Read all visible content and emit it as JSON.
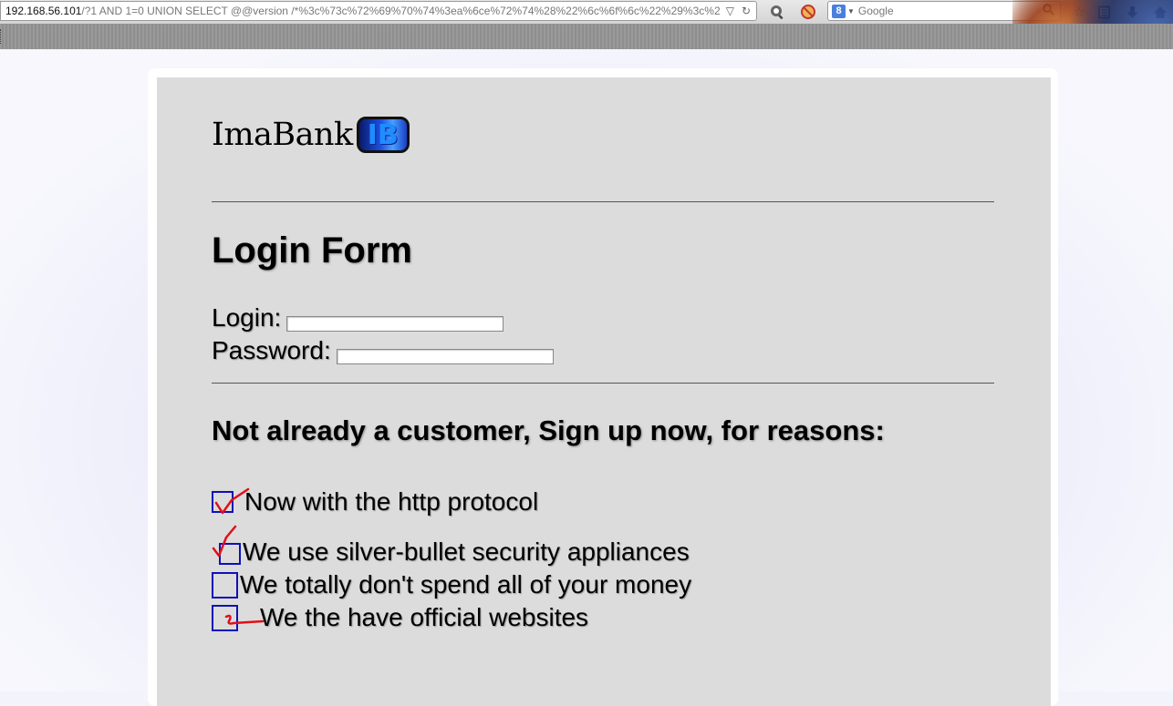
{
  "browser": {
    "url_host": "192.168.56.101",
    "url_path": "/?1 AND 1=0 UNION SELECT @@version /*%3c%73c%72%69%70%74%3ea%6ce%72%74%28%22%6c%6f%6c%22%29%3c%2",
    "search_engine_badge": "8",
    "search_placeholder": "Google",
    "icons": [
      "dropdown-arrow-icon",
      "reload-icon",
      "search-addon-icon",
      "blocked-icon",
      "search-magnifier-icon",
      "star-icon",
      "bookmarks-icon",
      "download-icon",
      "home-icon"
    ]
  },
  "page": {
    "logo_text": "ImaBank",
    "logo_badge": "IB",
    "title": "Login Form",
    "login_label": "Login:",
    "login_value": "",
    "password_label": "Password:",
    "password_value": "",
    "signup_heading": "Not already a customer, Sign up now, for reasons:",
    "reasons": [
      {
        "label": "Now with the http protocol",
        "mark": "check"
      },
      {
        "label": "We use silver-bullet security appliances",
        "mark": "check-outside"
      },
      {
        "label": "We totally don't spend all of your money",
        "mark": "none"
      },
      {
        "label": "We the have official websites",
        "mark": "squiggle"
      }
    ]
  },
  "colors": {
    "content_bg": "#dcdcdc",
    "checkbox_border": "#1010b8",
    "hand_mark": "#e0101a"
  }
}
